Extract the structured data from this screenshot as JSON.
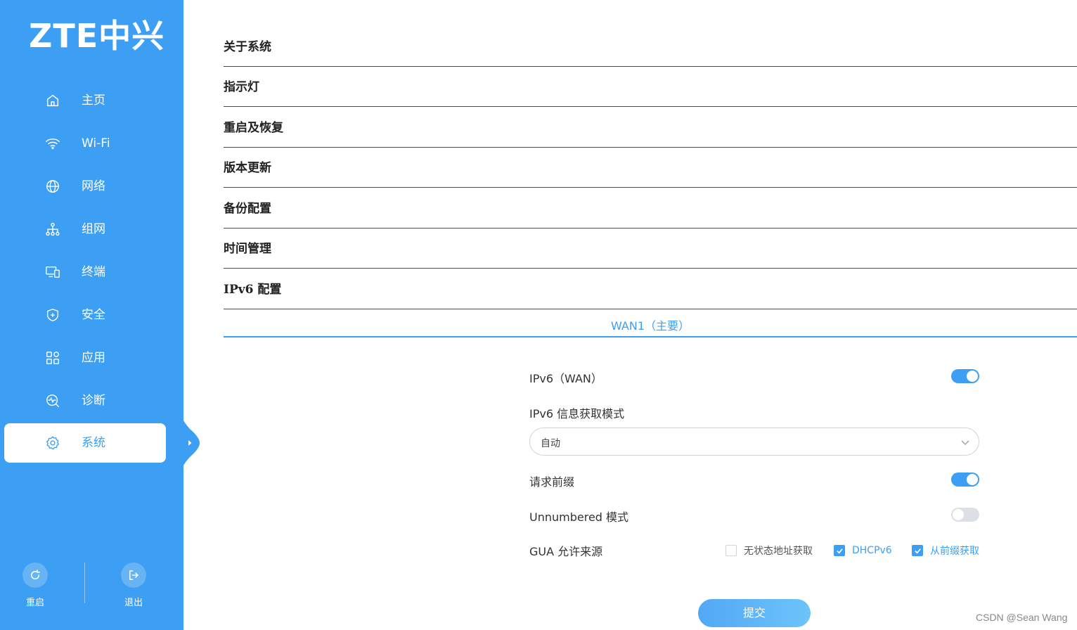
{
  "brand": {
    "logo_text": "ZTE中兴"
  },
  "sidebar": {
    "items": [
      {
        "label": "主页",
        "icon": "home-icon"
      },
      {
        "label": "Wi-Fi",
        "icon": "wifi-icon"
      },
      {
        "label": "网络",
        "icon": "globe-icon"
      },
      {
        "label": "组网",
        "icon": "mesh-icon"
      },
      {
        "label": "终端",
        "icon": "devices-icon"
      },
      {
        "label": "安全",
        "icon": "shield-icon"
      },
      {
        "label": "应用",
        "icon": "apps-icon"
      },
      {
        "label": "诊断",
        "icon": "diagnose-icon"
      },
      {
        "label": "系统",
        "icon": "gear-icon",
        "active": true
      }
    ],
    "reboot_label": "重启",
    "logout_label": "退出"
  },
  "system_menu": {
    "items": [
      "关于系统",
      "指示灯",
      "重启及恢复",
      "版本更新",
      "备份配置",
      "时间管理",
      "IPv6 配置"
    ]
  },
  "ipv6": {
    "tab_label": "WAN1（主要）",
    "wan_label": "IPv6（WAN）",
    "wan_enabled": true,
    "mode_label": "IPv6 信息获取模式",
    "mode_value": "自动",
    "prefix_label": "请求前缀",
    "prefix_enabled": true,
    "unnumbered_label": "Unnumbered 模式",
    "unnumbered_enabled": false,
    "gua_label": "GUA 允许来源",
    "gua_options": [
      {
        "label": "无状态地址获取",
        "checked": false
      },
      {
        "label": "DHCPv6",
        "checked": true
      },
      {
        "label": "从前缀获取",
        "checked": true
      }
    ],
    "submit_label": "提交"
  },
  "watermark": "CSDN @Sean Wang",
  "colors": {
    "accent": "#3d9ff3",
    "sidebar_bg": "#3d9ff3"
  }
}
